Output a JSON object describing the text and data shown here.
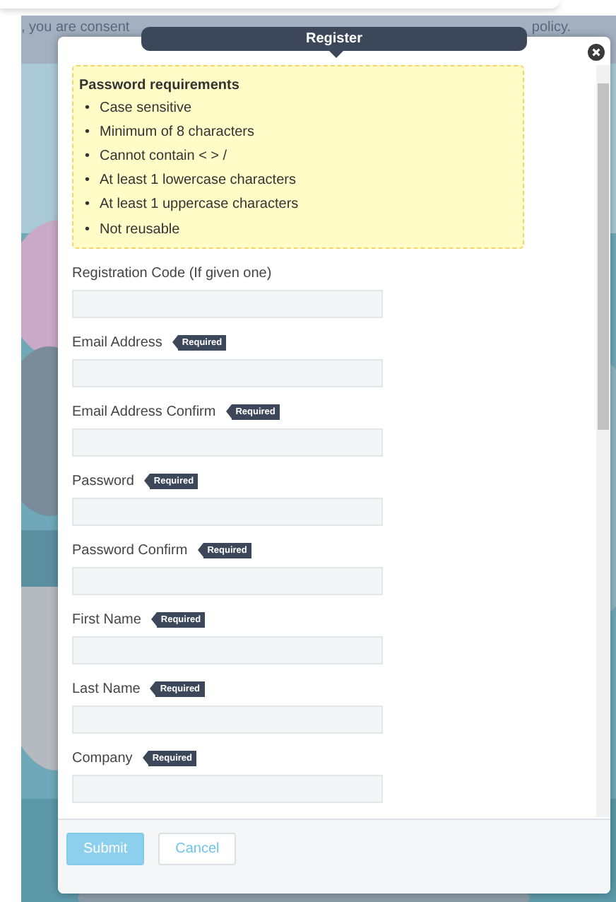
{
  "background": {
    "text_left": ", you are consent",
    "text_right": "policy."
  },
  "dialog": {
    "title": "Register",
    "password_requirements": {
      "title": "Password requirements",
      "bullet": "•",
      "items": [
        "Case sensitive",
        "Minimum of 8 characters",
        "Cannot contain < > /",
        "At least 1 lowercase characters",
        "At least 1 uppercase characters",
        "Not reusable"
      ]
    },
    "fields": [
      {
        "label": "Registration Code (If given one)"
      },
      {
        "label": "Email Address",
        "badge": "Required"
      },
      {
        "label": "Email Address Confirm",
        "badge": "Required"
      },
      {
        "label": "Password",
        "badge": "Required"
      },
      {
        "label": "Password Confirm",
        "badge": "Required"
      },
      {
        "label": "First Name",
        "badge": "Required"
      },
      {
        "label": "Last Name",
        "badge": "Required"
      },
      {
        "label": "Company",
        "badge": "Required"
      }
    ],
    "buttons": [
      {
        "label": "Submit",
        "kind": "primary",
        "disabled": true
      },
      {
        "label": "Cancel",
        "kind": "secondary",
        "disabled": false
      }
    ]
  }
}
